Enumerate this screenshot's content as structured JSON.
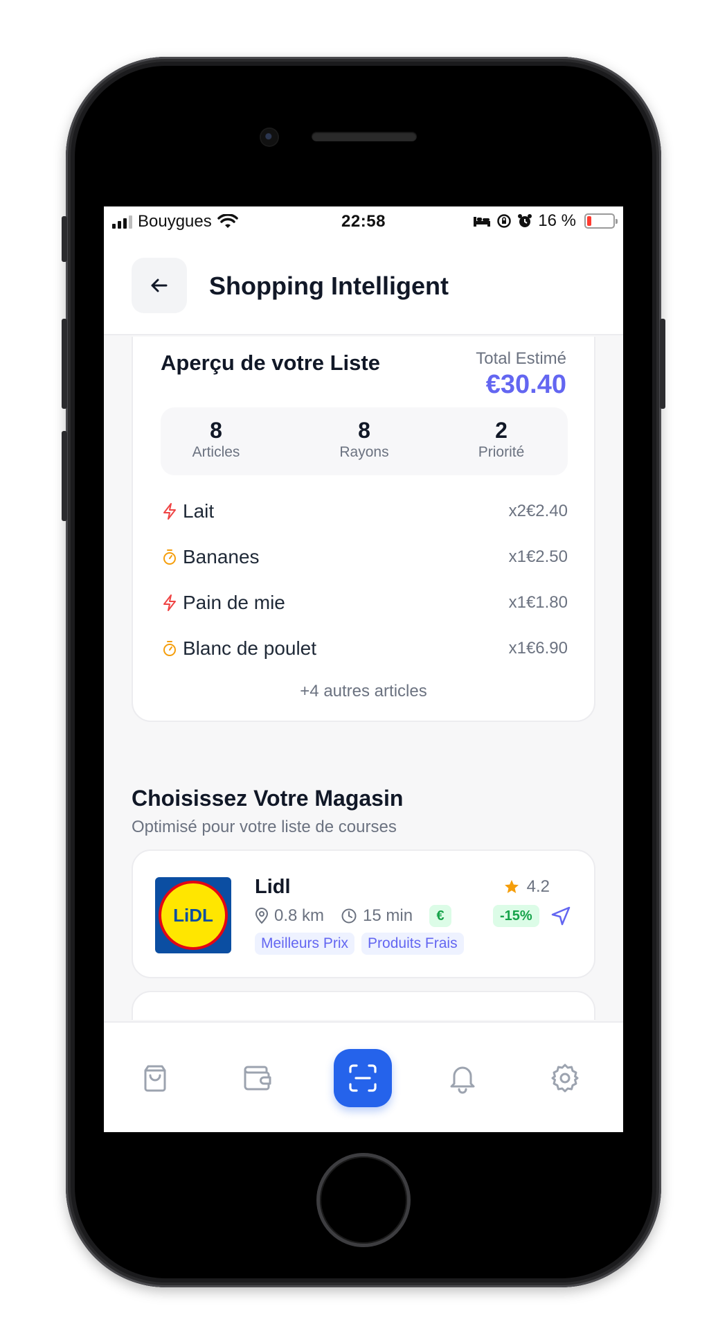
{
  "status_bar": {
    "carrier": "Bouygues",
    "time": "22:58",
    "battery_text": "16 %",
    "battery_level_percent": 16
  },
  "header": {
    "title": "Shopping Intelligent"
  },
  "list_overview": {
    "title": "Aperçu de votre Liste",
    "total_label": "Total Estimé",
    "total_value": "€30.40",
    "stats": [
      {
        "value": "8",
        "label": "Articles"
      },
      {
        "value": "8",
        "label": "Rayons"
      },
      {
        "value": "2",
        "label": "Priorité"
      }
    ],
    "items": [
      {
        "name": "Lait",
        "meta": "x2€2.40",
        "icon": "lightning-icon"
      },
      {
        "name": "Bananes",
        "meta": "x1€2.50",
        "icon": "timer-icon"
      },
      {
        "name": "Pain de mie",
        "meta": "x1€1.80",
        "icon": "lightning-icon"
      },
      {
        "name": "Blanc de poulet",
        "meta": "x1€6.90",
        "icon": "timer-icon"
      }
    ],
    "more_text": "+4 autres articles"
  },
  "stores_section": {
    "title": "Choisissez Votre Magasin",
    "subtitle": "Optimisé pour votre liste de courses",
    "stores": [
      {
        "name": "Lidl",
        "logo_text": "LiDL",
        "distance": "0.8 km",
        "duration": "15 min",
        "price_level": "€",
        "rating": "4.2",
        "discount": "-15%",
        "tags": [
          "Meilleurs Prix",
          "Produits Frais"
        ]
      }
    ]
  },
  "tab_bar": {
    "tabs": [
      "bag-icon",
      "wallet-icon",
      "scan-icon",
      "bell-icon",
      "gear-icon"
    ],
    "active": "scan-icon"
  },
  "colors": {
    "accent": "#6366f1",
    "primary": "#2563eb",
    "priority_high": "#ef4444",
    "priority_medium": "#f59e0b",
    "success": "#16a34a"
  }
}
